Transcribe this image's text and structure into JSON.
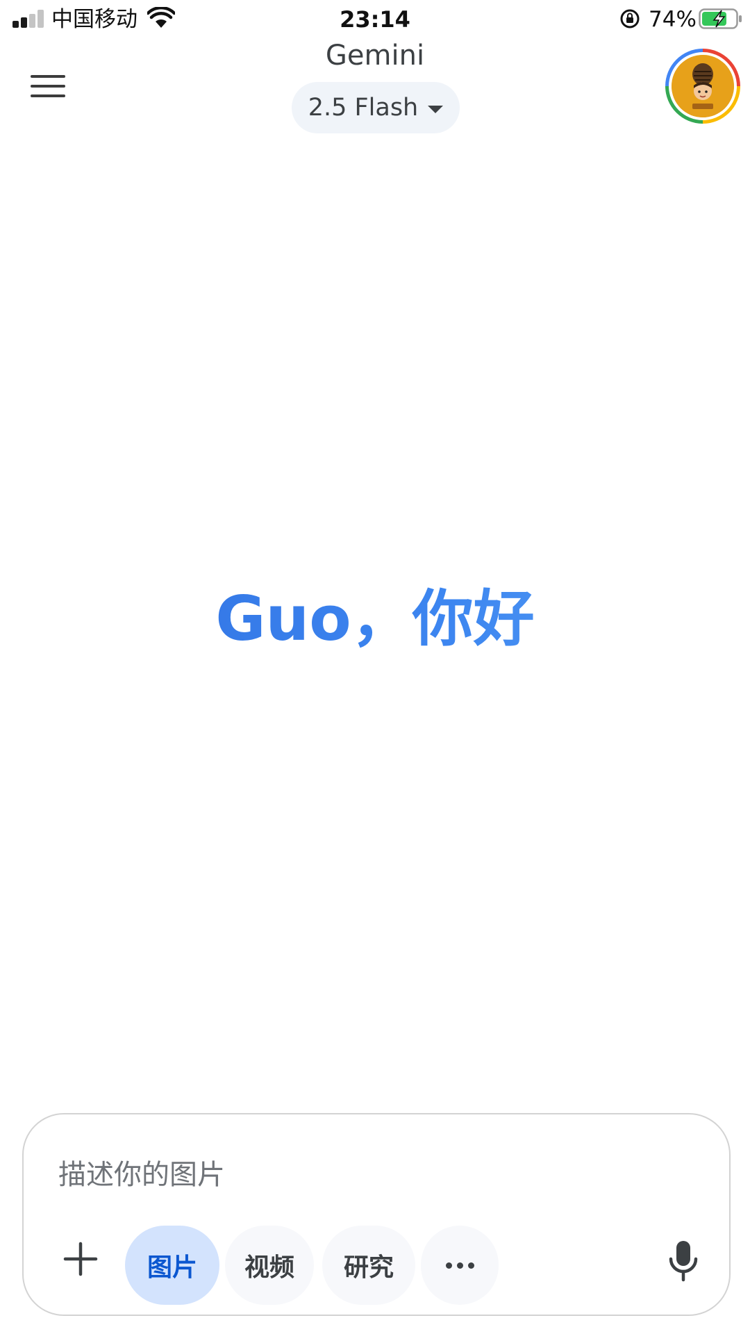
{
  "status_bar": {
    "carrier": "中国移动",
    "time": "23:14",
    "battery_percent": "74%",
    "signal_bars_active": 2,
    "signal_bars_total": 4,
    "battery_level": 0.74,
    "battery_color": "#34c759",
    "icons": [
      "signal-icon",
      "wifi-icon",
      "rotation-lock-icon",
      "battery-charging-icon"
    ]
  },
  "header": {
    "title": "Gemini",
    "model_picker": {
      "label": "2.5 Flash",
      "icon": "chevron-down-icon"
    },
    "menu_icon": "hamburger-menu-icon",
    "avatar_icon": "user-avatar"
  },
  "greeting": {
    "text": "Guo，你好",
    "color": "#3d86f0"
  },
  "composer": {
    "placeholder": "描述你的图片",
    "value": "",
    "add_icon": "plus-icon",
    "chips": [
      {
        "label": "图片",
        "active": true
      },
      {
        "label": "视频",
        "active": false
      },
      {
        "label": "研究",
        "active": false
      }
    ],
    "more_icon": "more-horizontal-icon",
    "mic_icon": "microphone-icon",
    "accent_color": "#0b57d0",
    "active_chip_bg": "#d3e3fd"
  }
}
